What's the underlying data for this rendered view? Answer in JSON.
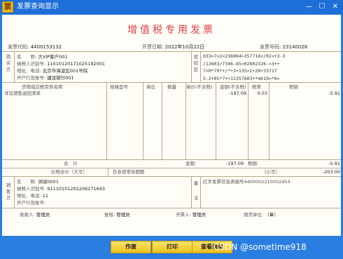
{
  "window": {
    "title": "发票查询显示",
    "icon_glyph": "票",
    "controls": [
      "—",
      "☐",
      "✕"
    ]
  },
  "invoice": {
    "title": "增值税专用发票",
    "code_label": "发票代码:",
    "code": "4400153132",
    "date_label": "开票日期:",
    "date": "2022年10月22日",
    "number_label": "发票号码:",
    "number": "23140028"
  },
  "buyer": {
    "side_label": [
      "购",
      "买",
      "方"
    ],
    "name_label": "名　　称:",
    "name": "大VIP客户001",
    "taxid_label": "纳税人识别号:",
    "taxid": "110101201710251920​01",
    "addr_label": "地址、电话:",
    "addr": "北京市海淀区001号院",
    "bank_label": "开户行及账号:",
    "bank": "建设银行001"
  },
  "cipher": {
    "side_label": [
      "密",
      "码",
      "区"
    ],
    "lines": [
      "033>7<2<236964>357718</02<+3-3",
      "/12603/7346-65<02802326-<3++",
      "7<0*79*+/*+3+135>1+29+33717",
      "5-2+05*7++11357603+*4619<*0>"
    ]
  },
  "items": {
    "headers": [
      "货物或应税劳务名称",
      "规格型号",
      "单位",
      "数量",
      "单价(不含税)",
      "金额(不含税)",
      "税率",
      "税额"
    ],
    "rows": [
      {
        "name": "详见销售退回清单",
        "spec": "",
        "unit": "",
        "qty": "",
        "price": "",
        "amount": "-197.09",
        "rate": "0.03",
        "tax": "-5.91"
      }
    ]
  },
  "totals": {
    "label": "合　计",
    "amount_label": "金额:",
    "amount": "-197.09",
    "tax_label": "税额:",
    "tax": "-5.91",
    "grand_label": "价税合计（大写）",
    "grand_words": "负叁佰零叁圆整",
    "grand_small_label": "（小写）",
    "grand_small": "-203.00"
  },
  "seller": {
    "side_label": [
      "销",
      "售",
      "方"
    ],
    "name_label": "名　　称:",
    "name": "测试0001",
    "taxid_label": "纳税人识别号:",
    "taxid": "91110101202206271643",
    "addr_label": "地址、电话:",
    "addr": "11",
    "bank_label": "开户行及账号:",
    "bank": ""
  },
  "remark": {
    "side_label": [
      "备",
      "注"
    ],
    "text": "红字发票信息表编号4400002210002454"
  },
  "signatures": {
    "payee_label": "收款人:",
    "payee": "管理员",
    "reviewer_label": "复核:",
    "reviewer": "管理员",
    "issuer_label": "开票人:",
    "issuer": "管理员",
    "seller_unit_label": "销货单位:",
    "seller_unit": "（章）"
  },
  "toolbar": {
    "void": "作废",
    "print": "打印",
    "query": "查看清单"
  },
  "watermark": "CSDN @sometime918",
  "colors": {
    "title_red": "#e03c3c",
    "window_blue": "#2a7de1",
    "button_yellow": "#f3c21a"
  }
}
